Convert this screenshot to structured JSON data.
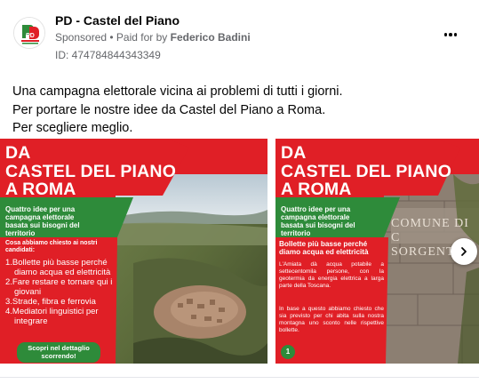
{
  "post": {
    "page_name": "PD - Castel del Piano",
    "sponsored": "Sponsored",
    "paid_for_prefix": "• Paid for by",
    "payer": "Federico Badini",
    "ad_id": "ID: 474784844343349",
    "more_icon": "more-dots-icon",
    "text_lines": [
      "Una campagna elettorale vicina ai problemi di tutti i giorni.",
      "Per portare le nostre idee da Castel del Piano a Roma.",
      "Per scegliere meglio."
    ]
  },
  "logo": {
    "letters": "PD",
    "small_text": "Partito Democratico",
    "town": "Castel del Piano"
  },
  "carousel": {
    "slide1": {
      "headline": [
        "DA",
        "CASTEL DEL PIANO",
        "A ROMA"
      ],
      "green_box": [
        "Quattro idee per una",
        "campagna elettorale",
        "basata sui bisogni del",
        "territorio"
      ],
      "question": [
        "Cosa abbiamo chiesto ai nostri",
        "candidati:"
      ],
      "items": [
        "1.Bollette più basse perché diamo acqua ed elettricità",
        "2.Fare restare e tornare qui i giovani",
        "3.Strade, fibra e ferrovia",
        "4.Mediatori linguistici per integrare"
      ],
      "cta": [
        "Scopri nel dettaglio",
        "scorrendo!"
      ]
    },
    "slide2": {
      "headline": [
        "DA",
        "CASTEL DEL PIANO",
        "A ROMA"
      ],
      "green_box": [
        "Quattro idee per una",
        "campagna elettorale",
        "basata sui bisogni del",
        "territorio"
      ],
      "bolletta_title": [
        "Bollette più basse perché",
        "diamo acqua ed elettricità"
      ],
      "paragraph1": "L'Amiata dà acqua potabile a settecentomila persone, con la geotermia da energia elettrica a larga parte della Toscana.",
      "paragraph2": "In base a questo abbiamo chiesto che sia previsto per chi abita sulla nostra montagna uno sconto nelle rispettive bollette.",
      "number": "1",
      "sign_lines": [
        "COMUNE DI C",
        "SORGENT"
      ]
    },
    "next_icon": "chevron-right-icon"
  },
  "colors": {
    "red": "#e01f26",
    "green": "#2e8b3a",
    "gray_text": "#65676b"
  }
}
